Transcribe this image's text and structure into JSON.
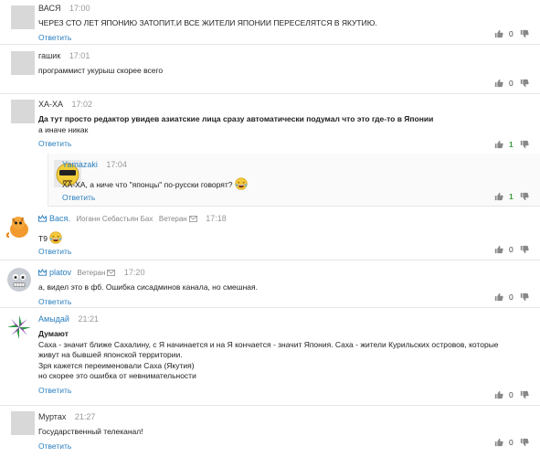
{
  "reply_label": "Ответить",
  "comments": [
    {
      "author": "ВАСЯ",
      "time": "17:00",
      "lines": [
        "ЧЕРЕЗ СТО ЛЕТ ЯПОНИЮ ЗАТОПИТ.И ВСЕ ЖИТЕЛИ ЯПОНИИ ПЕРЕСЕЛЯТСЯ В ЯКУТИЮ."
      ],
      "likes": "0"
    },
    {
      "author": "гашик",
      "time": "17:01",
      "lines": [
        "программист укурыш скорее всего"
      ],
      "likes": "0"
    },
    {
      "author": "ХА-ХА",
      "time": "17:02",
      "bold": "Да тут просто редактор увидев азиатские лица сразу автоматически подумал что это где-то в Японии",
      "lines": [
        "а иначе никак"
      ],
      "likes": "1"
    },
    {
      "author": "Yamazaki",
      "time": "17:04",
      "lines": [
        "ХА-ХА, а ниче что \"японцы\" по-русски говорят?"
      ],
      "likes": "1"
    },
    {
      "author": "Вася.",
      "rank_title": "Иоганн Себастьян Бах",
      "role": "Ветеран",
      "time": "17:18",
      "lines": [
        "Т9"
      ],
      "likes": "0"
    },
    {
      "author": "platov",
      "role": "Ветеран",
      "time": "17:20",
      "lines": [
        "а, видел это в фб. Ошибка сисадминов канала, но смешная."
      ],
      "likes": "0"
    },
    {
      "author": "Амыдай",
      "time": "21:21",
      "bold": "Думают",
      "lines": [
        "Саха - значит ближе Сахалину, с Я начинается и на Я кончается - значит Япония. Саха - жители Курильских островов, которые",
        "живут на бывшей японской территории.",
        "Зря кажется переименовали Саха (Якутия)",
        "но скорее это ошибка от невнимательности"
      ],
      "likes": "0"
    },
    {
      "author": "Муртах",
      "time": "21:27",
      "lines": [
        "Государственный телеканал!"
      ],
      "likes": "0"
    }
  ],
  "icons": {
    "like": "thumb-up-icon",
    "dislike": "thumb-down-icon",
    "envelope": "envelope-icon",
    "crown": "crown-icon",
    "emoji": "laughing-tears-emoji"
  },
  "colors": {
    "link": "#2a7fbf",
    "positive": "#3b9a3b",
    "divider": "#e6e6e6"
  }
}
